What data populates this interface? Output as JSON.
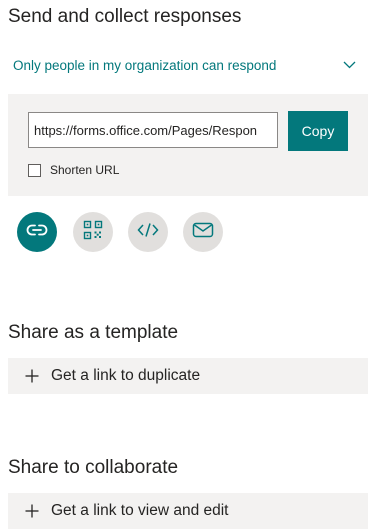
{
  "send": {
    "title": "Send and collect responses",
    "audience": "Only people in my organization can respond",
    "url_value": "https://forms.office.com/Pages/Respon",
    "copy_label": "Copy",
    "shorten_label": "Shorten URL",
    "shorten_checked": false,
    "share_options": [
      {
        "name": "link-icon",
        "active": true
      },
      {
        "name": "qr-code-icon",
        "active": false
      },
      {
        "name": "embed-code-icon",
        "active": false
      },
      {
        "name": "email-icon",
        "active": false
      }
    ]
  },
  "template": {
    "title": "Share as a template",
    "action": "Get a link to duplicate"
  },
  "collaborate": {
    "title": "Share to collaborate",
    "action": "Get a link to view and edit"
  },
  "colors": {
    "accent": "#03787c",
    "panel": "#f3f2f1",
    "icon_bg": "#e1dfdd",
    "text": "#252423"
  }
}
